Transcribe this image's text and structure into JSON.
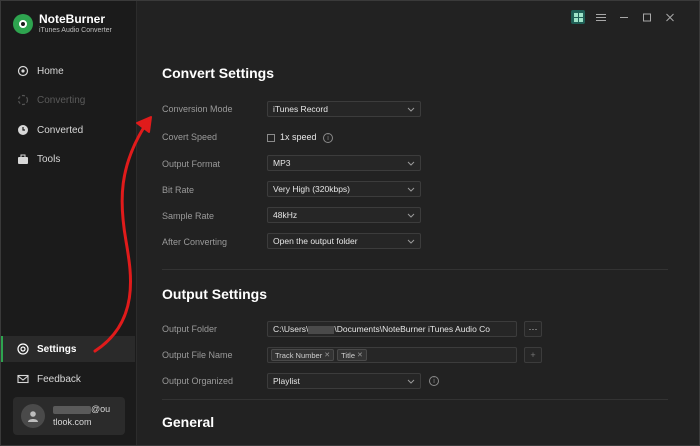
{
  "app": {
    "name": "NoteBurner",
    "subtitle": "iTunes Audio Converter"
  },
  "sidebar": {
    "items": [
      {
        "label": "Home",
        "icon": "home-icon"
      },
      {
        "label": "Converting",
        "icon": "converting-icon"
      },
      {
        "label": "Converted",
        "icon": "clock-icon"
      },
      {
        "label": "Tools",
        "icon": "toolbox-icon"
      }
    ],
    "settings_label": "Settings",
    "feedback_label": "Feedback",
    "account": {
      "email_suffix": "@ou",
      "email_line2": "tlook.com"
    }
  },
  "convert_settings": {
    "title": "Convert Settings",
    "conversion_mode": {
      "label": "Conversion Mode",
      "value": "iTunes Record"
    },
    "covert_speed": {
      "label": "Covert Speed",
      "option": "1x speed"
    },
    "output_format": {
      "label": "Output Format",
      "value": "MP3"
    },
    "bit_rate": {
      "label": "Bit Rate",
      "value": "Very High (320kbps)"
    },
    "sample_rate": {
      "label": "Sample Rate",
      "value": "48kHz"
    },
    "after_converting": {
      "label": "After Converting",
      "value": "Open the output folder"
    }
  },
  "output_settings": {
    "title": "Output Settings",
    "output_folder": {
      "label": "Output Folder",
      "path_prefix": "C:\\Users\\",
      "path_suffix": "\\Documents\\NoteBurner iTunes Audio Co",
      "browse_label": "···"
    },
    "output_file_name": {
      "label": "Output File Name",
      "tags": [
        "Track Number",
        "Title"
      ],
      "add_label": "+"
    },
    "output_organized": {
      "label": "Output Organized",
      "value": "Playlist"
    }
  },
  "general": {
    "title": "General"
  },
  "colors": {
    "accent": "#2ea44f",
    "annotation_arrow": "#e01b1b"
  }
}
